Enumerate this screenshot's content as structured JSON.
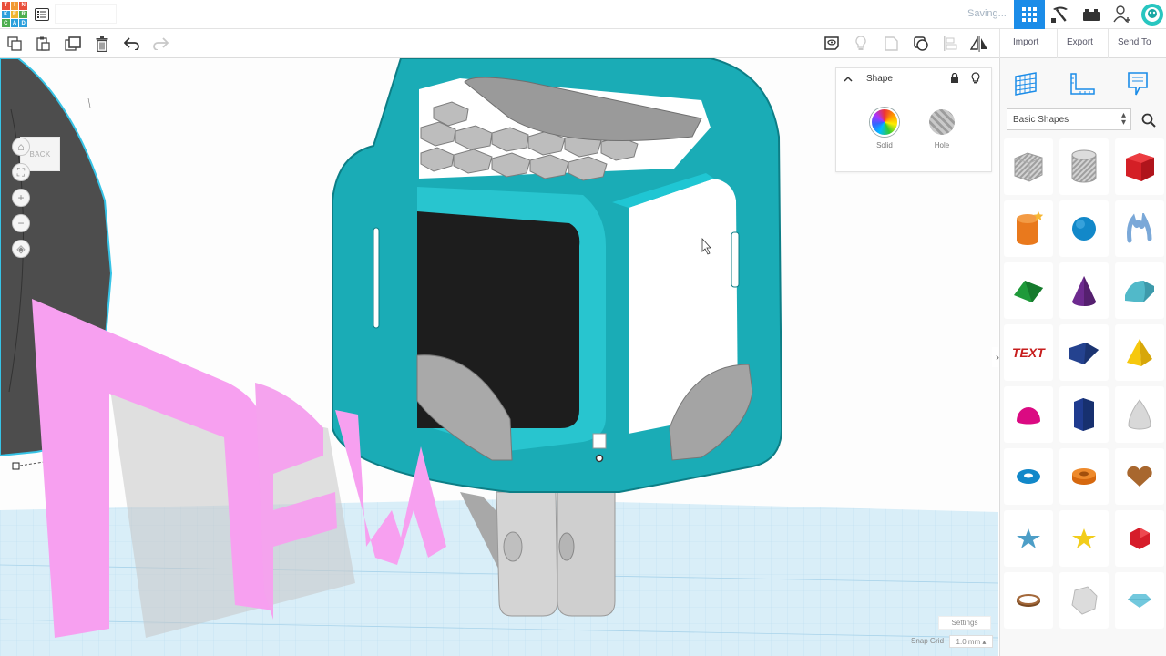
{
  "app": {
    "logo_letters": [
      "T",
      "I",
      "N",
      "K",
      "E",
      "R",
      "C",
      "A",
      "D"
    ],
    "design_name": "",
    "status": "Saving...",
    "accent": "#1b8ce8"
  },
  "topbar_icons": [
    "3d-view-grid-icon",
    "blocks-pickaxe-icon",
    "bricks-icon",
    "add-user-icon",
    "avatar-icon"
  ],
  "toolbar": {
    "left_tools": [
      "copy-icon",
      "paste-icon",
      "duplicate-icon",
      "delete-icon",
      "undo-icon",
      "redo-icon"
    ],
    "right_tools": [
      "notes-icon",
      "light-bulb-icon",
      "group-icon",
      "ungroup-icon",
      "align-icon",
      "mirror-icon"
    ],
    "import_label": "Import",
    "export_label": "Export",
    "send_to_label": "Send To"
  },
  "workplane": {
    "back_label": "BACK",
    "nav_icons": [
      "home-icon",
      "fit-view-icon",
      "zoom-in-icon",
      "zoom-out-icon",
      "perspective-icon"
    ],
    "colors": {
      "frame": "#1aacb6",
      "pink_text": "#f7a0f0",
      "grid": "#cde6f3"
    },
    "settings_label": "Settings",
    "snap_grid_label": "Snap Grid",
    "snap_grid_value": "1.0 mm ▴"
  },
  "inspector": {
    "title": "Shape",
    "solid_label": "Solid",
    "hole_label": "Hole"
  },
  "panel": {
    "tabs": [
      "workplane-grid-icon",
      "ruler-icon",
      "notes-tab-icon"
    ],
    "library": "Basic Shapes",
    "shapes": [
      [
        "box-hole",
        "cylinder-hole",
        "box-red"
      ],
      [
        "cylinder-orange",
        "sphere-blue",
        "scribble-blue"
      ],
      [
        "roof-green",
        "cone-purple",
        "round-roof-teal"
      ],
      [
        "text-red",
        "box-navy",
        "pyramid-yellow"
      ],
      [
        "half-sphere-magenta",
        "polygon-navy",
        "paraboloid-grey"
      ],
      [
        "torus-blue",
        "tube-orange",
        "heart-brown"
      ],
      [
        "star-blue",
        "star-yellow",
        "icosahedron-red"
      ],
      [
        "ring-brown",
        "sphere-grey",
        "diamond-teal"
      ]
    ]
  }
}
